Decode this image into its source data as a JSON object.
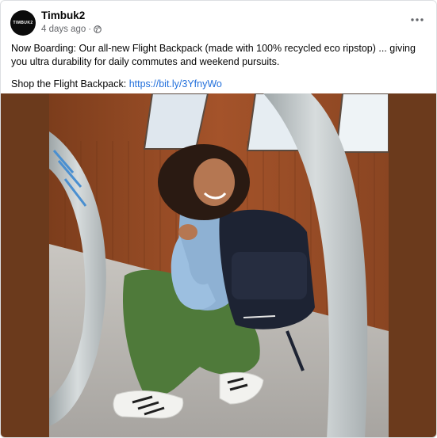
{
  "post": {
    "page_name": "Timbuk2",
    "avatar_text": "TIMBUK2",
    "timestamp": "4 days ago",
    "separator": "·",
    "caption_line1": "Now Boarding: Our all-new Flight Backpack (made with 100% recycled eco ripstop) ... giving you ultra durability for daily commutes and weekend pursuits.",
    "caption_line2_prefix": "Shop the Flight Backpack: ",
    "caption_link": "https://bit.ly/3YfnyWo"
  },
  "icons": {
    "privacy": "globe-icon",
    "more": "more-options-icon"
  },
  "colors": {
    "link": "#216fdb",
    "media_background": "#6b3a1c",
    "meta_text": "#65676b"
  }
}
